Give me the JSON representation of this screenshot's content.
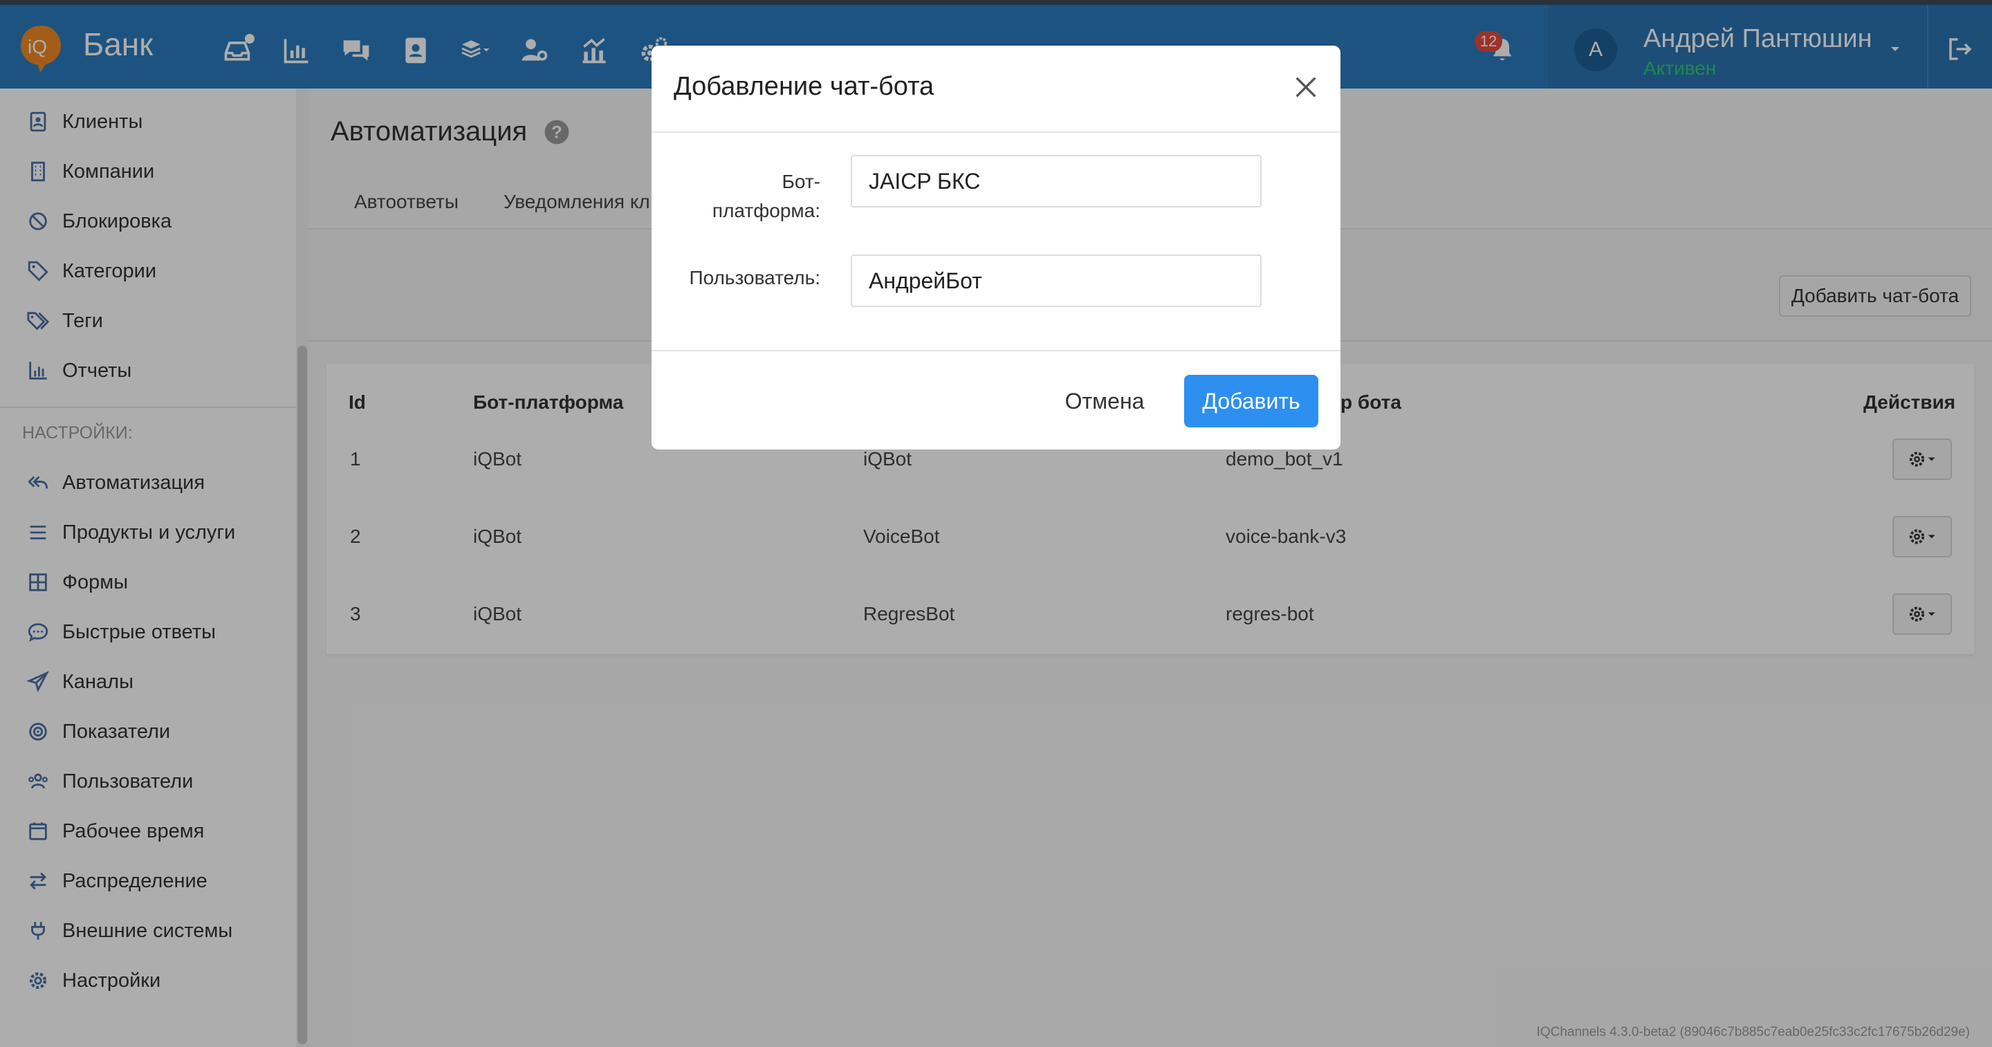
{
  "header": {
    "brand": "Банк",
    "notifications_count": "12",
    "user_initial": "А",
    "user_name": "Андрей Пантюшин",
    "user_status": "Активен"
  },
  "sidebar": {
    "items_top": [
      {
        "label": "Клиенты",
        "icon": "address-book-icon"
      },
      {
        "label": "Компании",
        "icon": "building-icon"
      },
      {
        "label": "Блокировка",
        "icon": "ban-icon"
      },
      {
        "label": "Категории",
        "icon": "tag-icon"
      },
      {
        "label": "Теги",
        "icon": "tags-icon"
      },
      {
        "label": "Отчеты",
        "icon": "bar-chart-icon"
      }
    ],
    "settings_heading": "НАСТРОЙКИ:",
    "items_settings": [
      {
        "label": "Автоматизация",
        "icon": "reply-all-icon"
      },
      {
        "label": "Продукты и услуги",
        "icon": "list-icon"
      },
      {
        "label": "Формы",
        "icon": "grid-icon"
      },
      {
        "label": "Быстрые ответы",
        "icon": "comment-dots-icon"
      },
      {
        "label": "Каналы",
        "icon": "paper-plane-icon"
      },
      {
        "label": "Показатели",
        "icon": "target-icon"
      },
      {
        "label": "Пользователи",
        "icon": "users-icon"
      },
      {
        "label": "Рабочее время",
        "icon": "calendar-icon"
      },
      {
        "label": "Распределение",
        "icon": "exchange-icon"
      },
      {
        "label": "Внешние системы",
        "icon": "plug-icon"
      },
      {
        "label": "Настройки",
        "icon": "gear-icon"
      }
    ]
  },
  "page": {
    "title": "Автоматизация",
    "tabs": [
      "Автоответы",
      "Уведомления кл"
    ],
    "add_bot_button": "Добавить чат-бота",
    "version": "IQChannels 4.3.0-beta2 (89046c7b885c7eab0e25fc33c2fc17675b26d29e)"
  },
  "table": {
    "headers": [
      "Id",
      "Бот-платформа",
      "атор бота",
      "Действия"
    ],
    "rows": [
      {
        "id": "1",
        "platform": "iQBot",
        "user": "iQBot",
        "identifier": "demo_bot_v1"
      },
      {
        "id": "2",
        "platform": "iQBot",
        "user": "VoiceBot",
        "identifier": "voice-bank-v3"
      },
      {
        "id": "3",
        "platform": "iQBot",
        "user": "RegresBot",
        "identifier": "regres-bot"
      }
    ]
  },
  "modal": {
    "title": "Добавление чат-бота",
    "platform_label_line1": "Бот-",
    "platform_label_line2": "платформа:",
    "platform_value": "JAICP БКС",
    "user_label": "Пользователь:",
    "user_value": "АндрейБот",
    "cancel_label": "Отмена",
    "submit_label": "Добавить"
  },
  "colors": {
    "header_bg": "#2b7bbd",
    "primary_button": "#2d8ff0",
    "status_online": "#2ecc71",
    "badge": "#e64a3c",
    "logo": "#f08a24"
  }
}
